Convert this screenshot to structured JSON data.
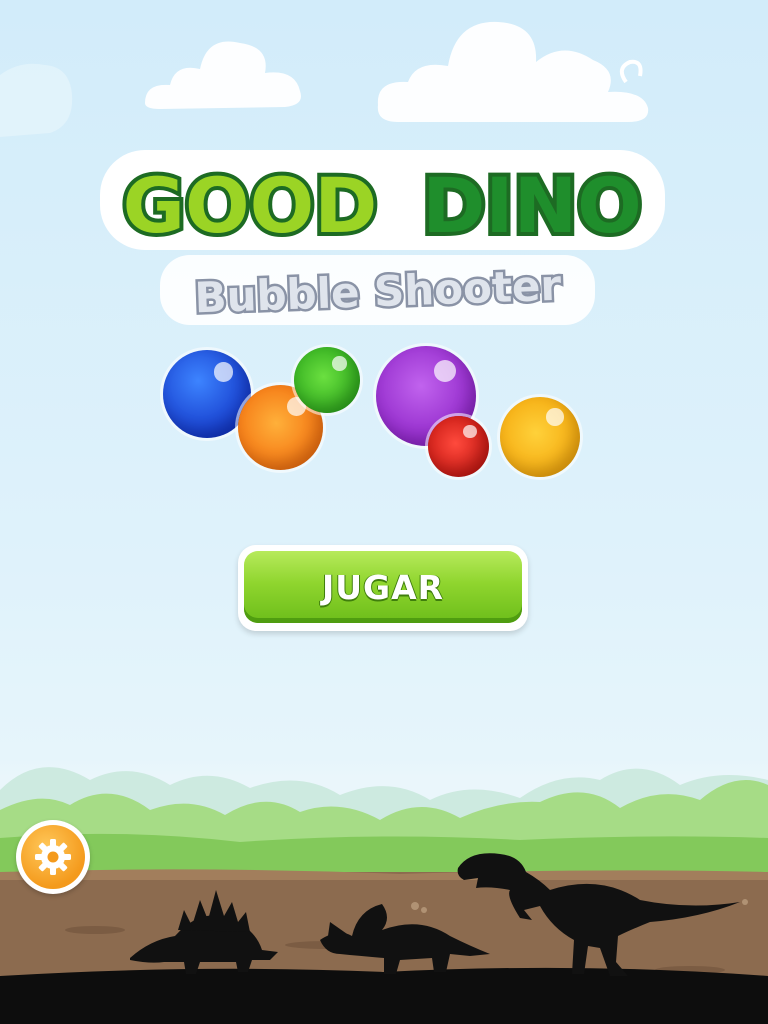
{
  "game": {
    "title_part1": "GOOD",
    "title_part2": "DINO",
    "subtitle": "Bubble Shooter"
  },
  "menu": {
    "play_label": "JUGAR"
  },
  "icons": {
    "settings": "gear-icon"
  },
  "bubbles": [
    {
      "color": "blue"
    },
    {
      "color": "orange"
    },
    {
      "color": "green"
    },
    {
      "color": "purple"
    },
    {
      "color": "red"
    },
    {
      "color": "yellow"
    }
  ],
  "colors": {
    "title_light_green": "#9bd425",
    "title_dark_green": "#1f8e2c",
    "title_outline": "#1d6b23",
    "button_green": "#8fd52e",
    "settings_orange": "#f49a1c",
    "ground": "#8c6b4f",
    "silhouette": "#111111"
  }
}
